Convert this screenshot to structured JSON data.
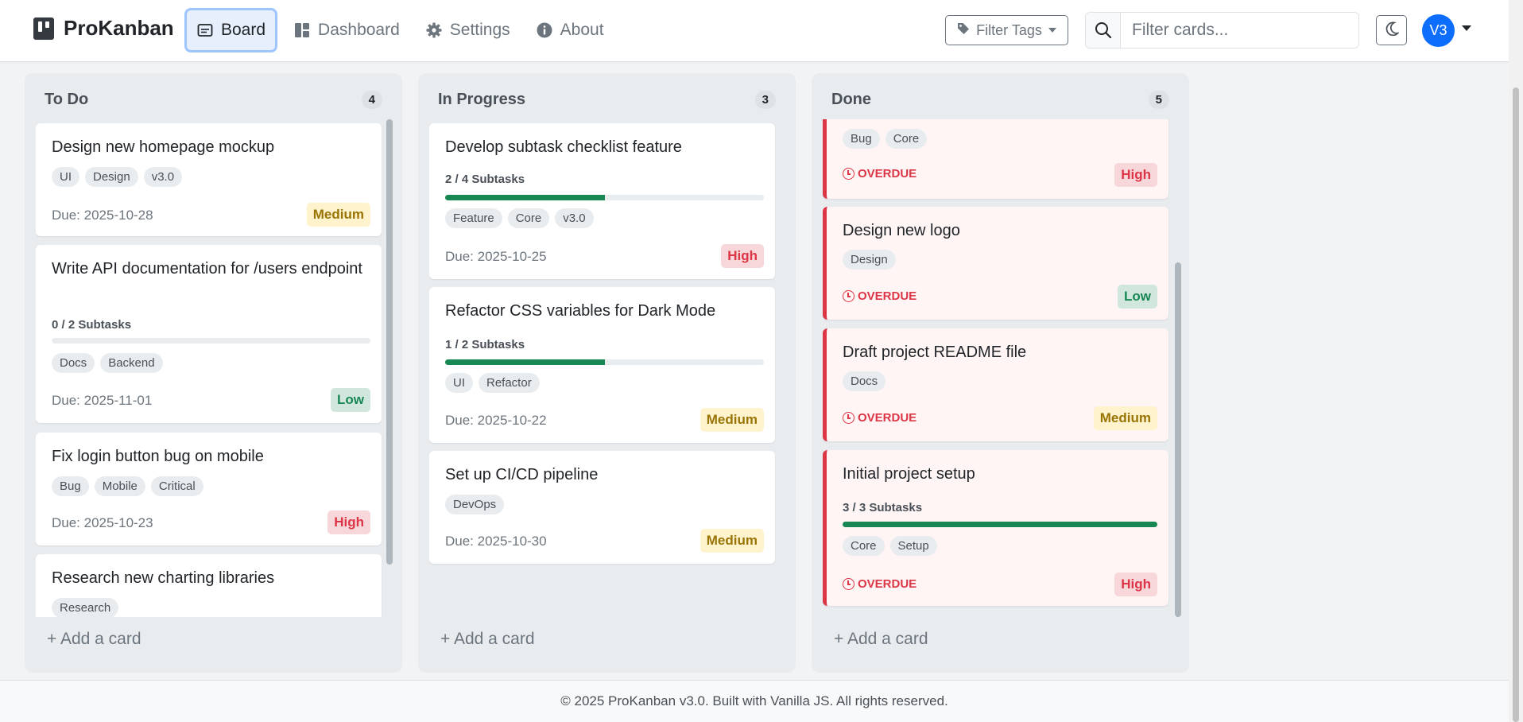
{
  "navbar": {
    "brand": "ProKanban",
    "links": [
      {
        "label": "Board",
        "icon": "board-icon",
        "active": true
      },
      {
        "label": "Dashboard",
        "icon": "dashboard-icon",
        "active": false
      },
      {
        "label": "Settings",
        "icon": "gear-icon",
        "active": false
      },
      {
        "label": "About",
        "icon": "info-icon",
        "active": false
      }
    ],
    "filter_tags_label": "Filter Tags",
    "search_placeholder": "Filter cards...",
    "avatar_initials": "V3"
  },
  "columns": [
    {
      "title": "To Do",
      "count": "4",
      "add_label": "+ Add a card",
      "cards": [
        {
          "title": "Design new homepage mockup",
          "tags": [
            "UI",
            "Design",
            "v3.0"
          ],
          "due": "Due: 2025-10-28",
          "priority": "Medium"
        },
        {
          "title": "Write API documentation for /users endpoint",
          "subtasks": "0 / 2 Subtasks",
          "progress": 0,
          "tags": [
            "Docs",
            "Backend"
          ],
          "due": "Due: 2025-11-01",
          "priority": "Low"
        },
        {
          "title": "Fix login button bug on mobile",
          "tags": [
            "Bug",
            "Mobile",
            "Critical"
          ],
          "due": "Due: 2025-10-23",
          "priority": "High"
        },
        {
          "title": "Research new charting libraries",
          "tags": [
            "Research"
          ]
        }
      ]
    },
    {
      "title": "In Progress",
      "count": "3",
      "add_label": "+ Add a card",
      "cards": [
        {
          "title": "Develop subtask checklist feature",
          "subtasks": "2 / 4 Subtasks",
          "progress": 0.5,
          "tags": [
            "Feature",
            "Core",
            "v3.0"
          ],
          "due": "Due: 2025-10-25",
          "priority": "High"
        },
        {
          "title": "Refactor CSS variables for Dark Mode",
          "subtasks": "1 / 2 Subtasks",
          "progress": 0.5,
          "tags": [
            "UI",
            "Refactor"
          ],
          "due": "Due: 2025-10-22",
          "priority": "Medium"
        },
        {
          "title": "Set up CI/CD pipeline",
          "tags": [
            "DevOps"
          ],
          "due": "Due: 2025-10-30",
          "priority": "Medium"
        }
      ]
    },
    {
      "title": "Done",
      "count": "5",
      "add_label": "+ Add a card",
      "cards": [
        {
          "tags": [
            "Bug",
            "Core"
          ],
          "overdue": "OVERDUE",
          "priority": "High"
        },
        {
          "title": "Design new logo",
          "tags": [
            "Design"
          ],
          "overdue": "OVERDUE",
          "priority": "Low"
        },
        {
          "title": "Draft project README file",
          "tags": [
            "Docs"
          ],
          "overdue": "OVERDUE",
          "priority": "Medium"
        },
        {
          "title": "Initial project setup",
          "subtasks": "3 / 3 Subtasks",
          "progress": 1,
          "tags": [
            "Core",
            "Setup"
          ],
          "overdue": "OVERDUE",
          "priority": "High"
        }
      ]
    }
  ],
  "footer": "© 2025 ProKanban v3.0. Built with Vanilla JS. All rights reserved."
}
